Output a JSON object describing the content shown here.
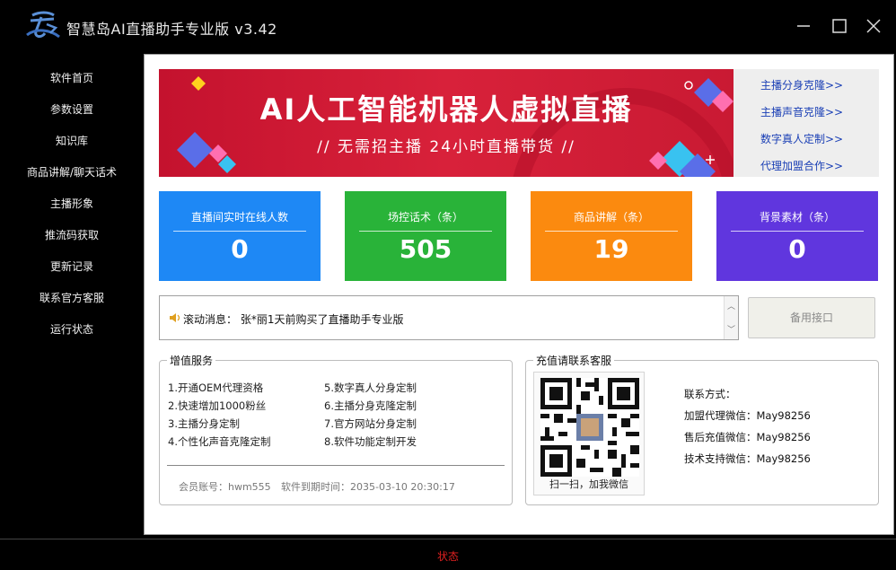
{
  "window": {
    "title": "智慧岛AI直播助手专业版 v3.42"
  },
  "sidebar": {
    "items": [
      {
        "label": "软件首页"
      },
      {
        "label": "参数设置"
      },
      {
        "label": "知识库"
      },
      {
        "label": "商品讲解/聊天话术"
      },
      {
        "label": "主播形象"
      },
      {
        "label": "推流码获取"
      },
      {
        "label": "更新记录"
      },
      {
        "label": "联系官方客服"
      },
      {
        "label": "运行状态"
      }
    ]
  },
  "banner": {
    "title": "AI人工智能机器人虚拟直播",
    "subtitle": "// 无需招主播  24小时直播带货 //"
  },
  "links": [
    {
      "label": "主播分身克隆>>"
    },
    {
      "label": "主播声音克隆>>"
    },
    {
      "label": "数字真人定制>>"
    },
    {
      "label": "代理加盟合作>>"
    }
  ],
  "stats": [
    {
      "label": "直播间实时在线人数",
      "value": "0",
      "color": "#1e88f5"
    },
    {
      "label": "场控话术（条）",
      "value": "505",
      "color": "#29b339"
    },
    {
      "label": "商品讲解（条）",
      "value": "19",
      "color": "#fb8a0f"
    },
    {
      "label": "背景素材（条）",
      "value": "0",
      "color": "#6036de"
    }
  ],
  "ticker": {
    "text": "滚动消息： 张*丽1天前购买了直播助手专业版"
  },
  "backup_button": {
    "label": "备用接口"
  },
  "services": {
    "title": "增值服务",
    "items": [
      "1.开通OEM代理资格",
      "2.快速增加1000粉丝",
      "3.主播分身定制",
      "4.个性化声音克隆定制",
      "5.数字真人分身定制",
      "6.主播分身克隆定制",
      "7.官方网站分身定制",
      "8.软件功能定制开发"
    ],
    "account_label": "会员账号：hwm555",
    "expiry_label": "软件到期时间：2035-03-10 20:30:17"
  },
  "recharge": {
    "title": "充值请联系客服",
    "qr_caption": "扫一扫，加我微信",
    "contact_title": "联系方式：",
    "contacts": [
      "加盟代理微信：May98256",
      "售后充值微信：May98256",
      "技术支持微信：May98256"
    ]
  },
  "status": {
    "text": "状态"
  },
  "colors": {
    "banner_red": "#d21c36",
    "link_blue": "#1a3fb5",
    "status_red": "#e02020"
  }
}
